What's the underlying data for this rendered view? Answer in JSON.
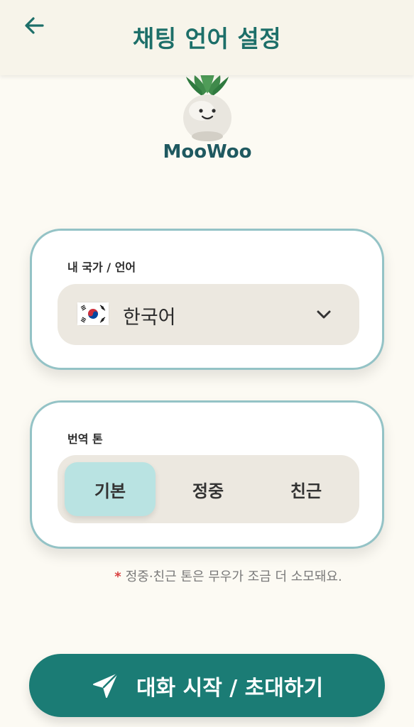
{
  "header": {
    "title": "채팅 언어 설정",
    "back_icon": "arrow-left-icon"
  },
  "logo": {
    "text": "MooWoo",
    "icon": "radish-mascot-icon"
  },
  "language_card": {
    "label": "내 국가 / 언어",
    "selected_flag": "south-korea-flag-icon",
    "selected_value": "한국어",
    "dropdown_icon": "chevron-down-icon"
  },
  "tone_card": {
    "label": "번역 톤",
    "options": [
      "기본",
      "정중",
      "친근"
    ],
    "selected": "기본"
  },
  "notice": {
    "marker": "*",
    "text": "정중·친근 톤은 무우가 조금 더 소모돼요."
  },
  "start_button": {
    "label": "대화 시작 / 초대하기",
    "icon": "send-icon"
  },
  "colors": {
    "primary": "#1b7c75",
    "title": "#1d6f69",
    "card_border": "#94c3c6",
    "selected_tone": "#b9e3e2",
    "background": "#fcfaf3"
  }
}
